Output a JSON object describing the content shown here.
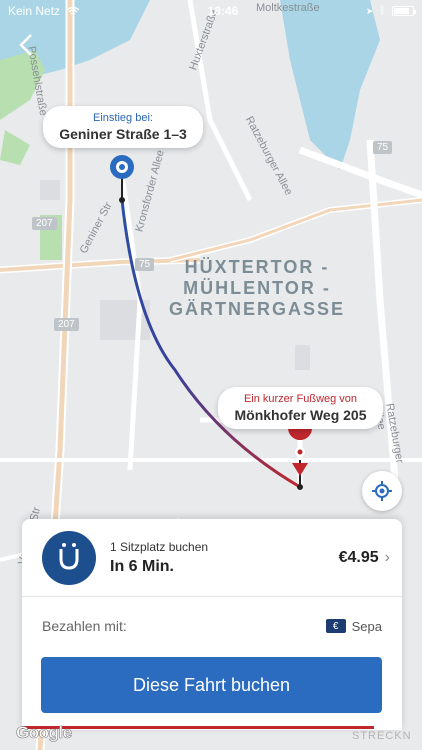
{
  "status": {
    "carrier": "Kein Netz",
    "time": "18:46",
    "battery_fraction": 0.85
  },
  "map": {
    "district": "HÜXTERTOR -\nMÜHLENTOR -\nGÄRTNERGASSE",
    "streets": {
      "moltkestrasse": "Moltkestraße",
      "huxterstrasse": "Huxterstraße",
      "ratzeburger_allee_top": "Ratzeburger Allee",
      "geniner": "Geniner Str",
      "kronsforder": "Kronsforder Allee",
      "ratzeburger_allee_bottom": "Ratzeburger Allee",
      "voraueder": "Vorrader Str",
      "possehlstr": "Possehlstraße",
      "left_street": "Geniner Str"
    },
    "road_numbers": [
      "75",
      "207",
      "75",
      "207"
    ]
  },
  "start_bubble": {
    "subtitle": "Einstieg bei:",
    "title": "Geniner Straße 1–3"
  },
  "end_bubble": {
    "subtitle": "Ein kurzer Fußweg von",
    "title": "Mönkhofer Weg 205"
  },
  "ride": {
    "seats": "1 Sitzplatz buchen",
    "eta": "In 6 Min.",
    "price": "€4.95",
    "pay_label": "Bezahlen mit:",
    "pay_method": "Sepa",
    "pay_icon": "€",
    "book_button": "Diese Fahrt buchen"
  },
  "attribution": {
    "google": "Google",
    "watermark": "STRECKN"
  },
  "icons": {
    "back": "chevron-left-icon",
    "locate": "crosshair-icon",
    "logo": "rider-logo-icon",
    "chevron": "chevron-right-icon",
    "sepa": "euro-card-icon"
  },
  "colors": {
    "accent_blue": "#2b6cc0",
    "route_red": "#c0272d",
    "logo_blue": "#1d4f8f"
  }
}
